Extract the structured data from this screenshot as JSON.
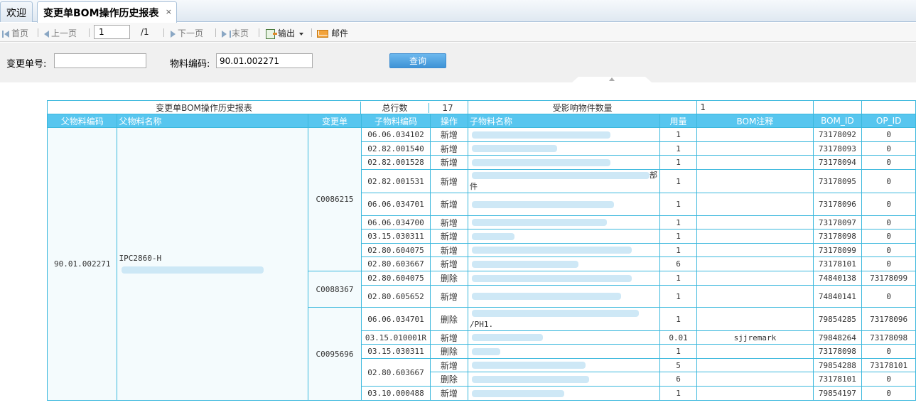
{
  "tabs": [
    {
      "label": "欢迎"
    },
    {
      "label": "变更单BOM操作历史报表",
      "close": "×"
    }
  ],
  "toolbar": {
    "first": "首页",
    "prev": "上一页",
    "page_value": "1",
    "page_total": "/1",
    "next": "下一页",
    "last": "末页",
    "export": "输出",
    "mail": "邮件"
  },
  "search": {
    "change_no_label": "变更单号:",
    "change_no_value": "",
    "material_label": "物料编码:",
    "material_value": "90.01.002271",
    "query_button": "查询"
  },
  "report": {
    "title": "变更单BOM操作历史报表",
    "total_rows_label": "总行数",
    "total_rows_value": "17",
    "affected_label": "受影响物件数量",
    "affected_value": "1",
    "headers": [
      "父物料编码",
      "父物料名称",
      "变更单",
      "子物料编码",
      "操作",
      "子物料名称",
      "用量",
      "BOM注释",
      "BOM_ID",
      "OP_ID"
    ],
    "parent_code": "90.01.002271",
    "parent_name": "IPC2860-H",
    "groups": [
      {
        "change": "C0086215",
        "rows": [
          {
            "code": "06.06.034102",
            "op": "新增",
            "name": "",
            "qty": "1",
            "note": "",
            "bom_id": "73178092",
            "op_id": "0"
          },
          {
            "code": "02.82.001540",
            "op": "新增",
            "name": "",
            "qty": "1",
            "note": "",
            "bom_id": "73178093",
            "op_id": "0"
          },
          {
            "code": "02.82.001528",
            "op": "新增",
            "name": "",
            "qty": "1",
            "note": "",
            "bom_id": "73178094",
            "op_id": "0"
          },
          {
            "code": "02.82.001531",
            "op": "新增",
            "name": "部件",
            "qty": "1",
            "note": "",
            "bom_id": "73178095",
            "op_id": "0"
          },
          {
            "code": "06.06.034701",
            "op": "新增",
            "name": "",
            "qty": "1",
            "note": "",
            "bom_id": "73178096",
            "op_id": "0"
          },
          {
            "code": "06.06.034700",
            "op": "新增",
            "name": "",
            "qty": "1",
            "note": "",
            "bom_id": "73178097",
            "op_id": "0"
          },
          {
            "code": "03.15.030311",
            "op": "新增",
            "name": "",
            "qty": "1",
            "note": "",
            "bom_id": "73178098",
            "op_id": "0"
          },
          {
            "code": "02.80.604075",
            "op": "新增",
            "name": "",
            "qty": "1",
            "note": "",
            "bom_id": "73178099",
            "op_id": "0"
          },
          {
            "code": "02.80.603667",
            "op": "新增",
            "name": "",
            "qty": "6",
            "note": "",
            "bom_id": "73178101",
            "op_id": "0"
          }
        ]
      },
      {
        "change": "C0088367",
        "rows": [
          {
            "code": "02.80.604075",
            "op": "删除",
            "name": "",
            "qty": "1",
            "note": "",
            "bom_id": "74840138",
            "op_id": "73178099"
          },
          {
            "code": "02.80.605652",
            "op": "新增",
            "name": "",
            "qty": "1",
            "note": "",
            "bom_id": "74840141",
            "op_id": "0"
          }
        ]
      },
      {
        "change": "C0095696",
        "rows": [
          {
            "code": "06.06.034701",
            "op": "删除",
            "name": "/PH1.",
            "qty": "1",
            "note": "",
            "bom_id": "79854285",
            "op_id": "73178096"
          },
          {
            "code": "03.15.010001R",
            "op": "新增",
            "name": "",
            "qty": "0.01",
            "note": "sjjremark",
            "bom_id": "79848264",
            "op_id": "73178098"
          },
          {
            "code": "03.15.030311",
            "op": "删除",
            "name": "",
            "qty": "1",
            "note": "",
            "bom_id": "73178098",
            "op_id": "0"
          },
          {
            "code": "02.80.603667",
            "op": "新增",
            "name": "",
            "qty": "5",
            "note": "",
            "bom_id": "79854288",
            "op_id": "73178101"
          },
          {
            "code": "",
            "op": "删除",
            "name": "",
            "qty": "6",
            "note": "",
            "bom_id": "73178101",
            "op_id": "0"
          },
          {
            "code": "03.10.000488",
            "op": "新增",
            "name": "",
            "qty": "1",
            "note": "",
            "bom_id": "79854197",
            "op_id": "0"
          }
        ]
      }
    ]
  }
}
